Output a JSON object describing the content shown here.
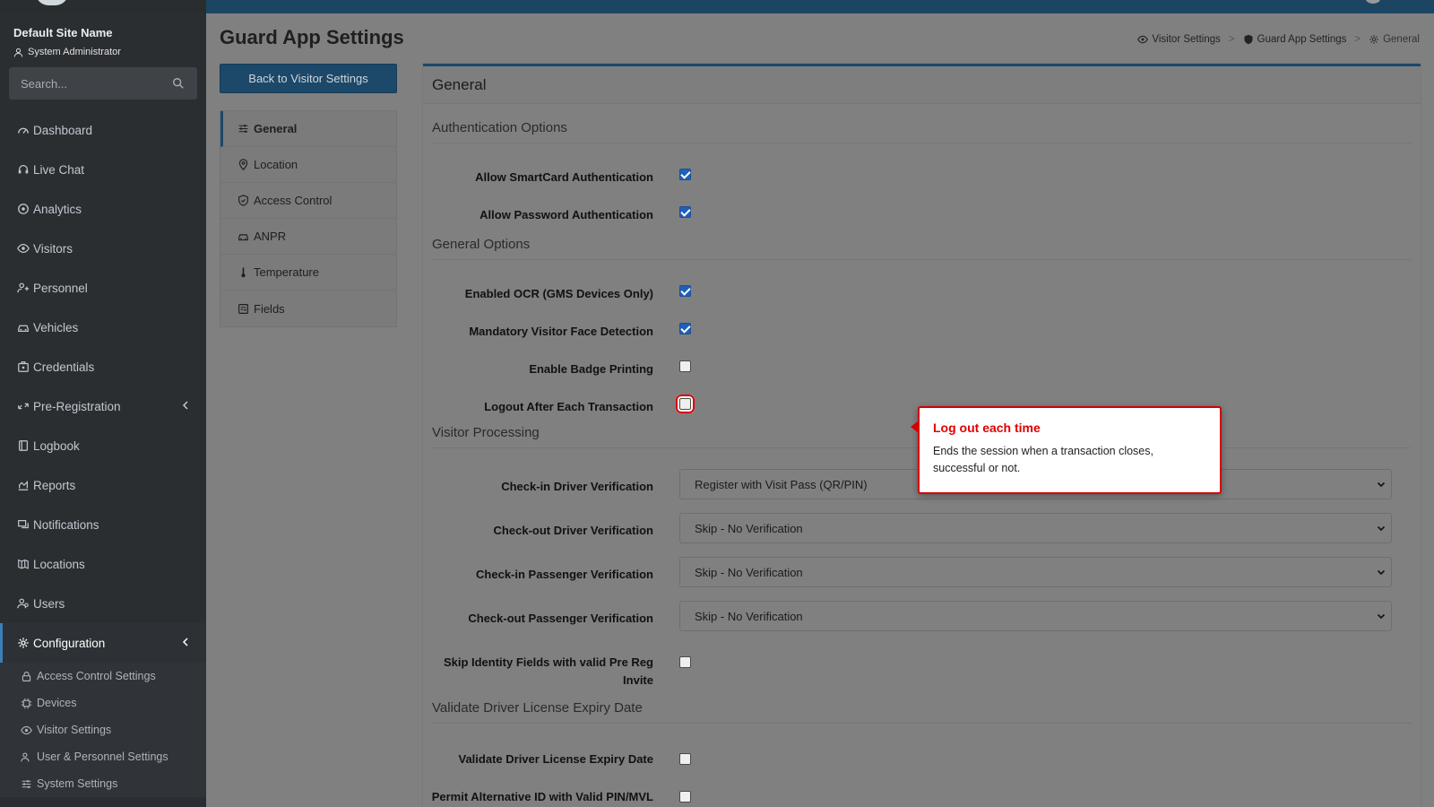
{
  "sidebar": {
    "site_name": "Default Site Name",
    "role": "System Administrator",
    "search_placeholder": "Search...",
    "items": [
      {
        "label": "Dashboard",
        "icon": "dashboard-icon"
      },
      {
        "label": "Live Chat",
        "icon": "headset-icon"
      },
      {
        "label": "Analytics",
        "icon": "analytics-icon"
      },
      {
        "label": "Visitors",
        "icon": "eye-icon"
      },
      {
        "label": "Personnel",
        "icon": "personnel-icon"
      },
      {
        "label": "Vehicles",
        "icon": "car-icon"
      },
      {
        "label": "Credentials",
        "icon": "credentials-icon"
      },
      {
        "label": "Pre-Registration",
        "icon": "arrows-icon"
      },
      {
        "label": "Logbook",
        "icon": "book-icon"
      },
      {
        "label": "Reports",
        "icon": "reports-icon"
      },
      {
        "label": "Notifications",
        "icon": "notifications-icon"
      },
      {
        "label": "Locations",
        "icon": "map-icon"
      },
      {
        "label": "Users",
        "icon": "users-icon"
      },
      {
        "label": "Configuration",
        "icon": "gear-icon"
      }
    ],
    "sub_items": [
      {
        "label": "Access Control Settings",
        "icon": "lock-icon"
      },
      {
        "label": "Devices",
        "icon": "chip-icon"
      },
      {
        "label": "Visitor Settings",
        "icon": "eye-icon"
      },
      {
        "label": "User & Personnel Settings",
        "icon": "users-icon"
      },
      {
        "label": "System Settings",
        "icon": "sliders-icon"
      }
    ]
  },
  "page": {
    "title": "Guard App Settings",
    "back_button": "Back to Visitor Settings",
    "breadcrumb": [
      "Visitor Settings",
      "Guard App Settings",
      "General"
    ]
  },
  "tabs": [
    {
      "label": "General"
    },
    {
      "label": "Location"
    },
    {
      "label": "Access Control"
    },
    {
      "label": "ANPR"
    },
    {
      "label": "Temperature"
    },
    {
      "label": "Fields"
    }
  ],
  "card": {
    "header": "General",
    "sections": {
      "auth": "Authentication Options",
      "general": "General Options",
      "visitor": "Visitor Processing",
      "license": "Validate Driver License Expiry Date"
    },
    "auth_options": [
      {
        "label": "Allow SmartCard Authentication",
        "checked": true
      },
      {
        "label": "Allow Password Authentication",
        "checked": true
      }
    ],
    "general_options": [
      {
        "label": "Enabled OCR (GMS Devices Only)",
        "checked": true
      },
      {
        "label": "Mandatory Visitor Face Detection",
        "checked": true
      },
      {
        "label": "Enable Badge Printing",
        "checked": false
      },
      {
        "label": "Logout After Each Transaction",
        "checked": false
      }
    ],
    "visitor_processing": [
      {
        "label": "Check-in Driver Verification",
        "value": "Register with Visit Pass (QR/PIN)"
      },
      {
        "label": "Check-out Driver Verification",
        "value": "Skip - No Verification"
      },
      {
        "label": "Check-in Passenger Verification",
        "value": "Skip - No Verification"
      },
      {
        "label": "Check-out Passenger Verification",
        "value": "Skip - No Verification"
      }
    ],
    "skip_identity": {
      "label": "Skip Identity Fields with valid Pre Reg Invite",
      "checked": false
    },
    "license_options": [
      {
        "label": "Validate Driver License Expiry Date",
        "checked": false
      },
      {
        "label": "Permit Alternative ID with Valid PIN/MVL",
        "checked": false
      }
    ]
  },
  "callout": {
    "title": "Log out each time",
    "body": "Ends the session when a transaction closes, successful or not."
  }
}
